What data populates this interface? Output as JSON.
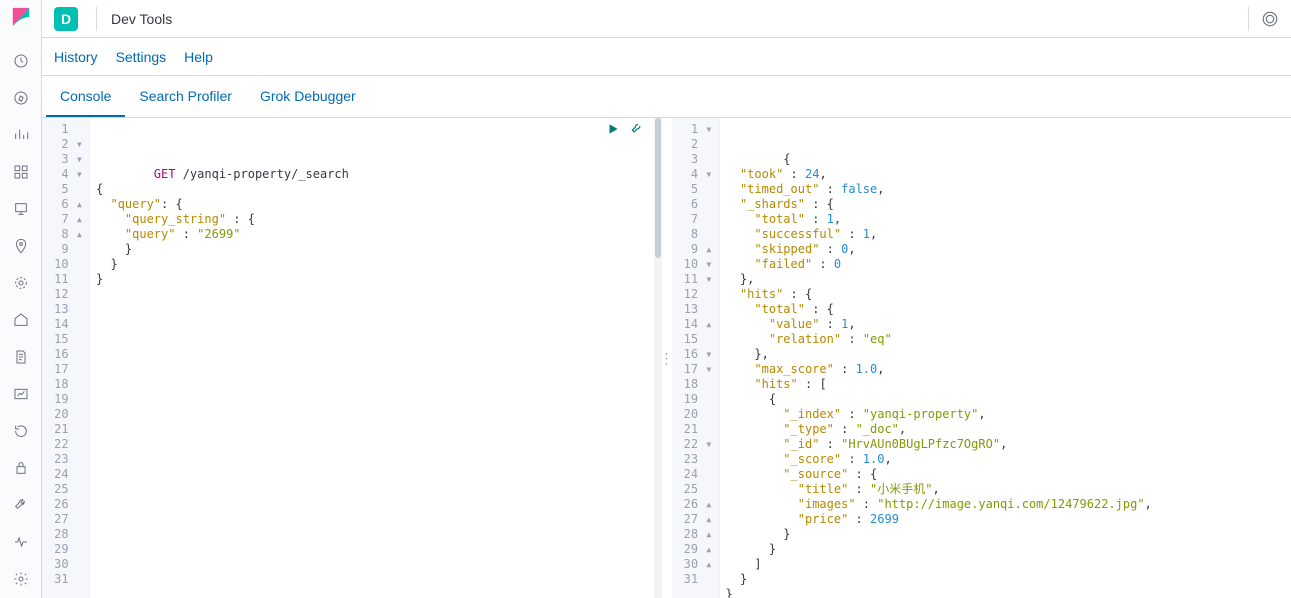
{
  "header": {
    "badge_letter": "D",
    "title": "Dev Tools"
  },
  "menubar": {
    "history": "History",
    "settings": "Settings",
    "help": "Help"
  },
  "tabs": {
    "console": "Console",
    "search_profiler": "Search Profiler",
    "grok_debugger": "Grok Debugger",
    "active": "console"
  },
  "request_editor": {
    "total_lines": 31,
    "gutter_markers": {
      "2": "▾",
      "3": "▾",
      "4": "▾",
      "6": "▴",
      "7": "▴",
      "8": "▴"
    },
    "code": {
      "method": "GET",
      "path": "/yanqi-property/_search",
      "lines": [
        {
          "n": 1,
          "type": "req"
        },
        {
          "n": 2,
          "raw": "{"
        },
        {
          "n": 3,
          "key": "query",
          "after": ": {"
        },
        {
          "n": 4,
          "key": "query_string",
          "after": " : {",
          "indent": "    "
        },
        {
          "n": 5,
          "key": "query",
          "after": " : ",
          "str": "2699",
          "indent": "    "
        },
        {
          "n": 6,
          "raw": "    }"
        },
        {
          "n": 7,
          "raw": "  }"
        },
        {
          "n": 8,
          "raw": "}"
        }
      ]
    }
  },
  "response_editor": {
    "total_lines": 31,
    "gutter_markers": {
      "1": "▾",
      "4": "▾",
      "9": "▴",
      "10": "▾",
      "11": "▾",
      "14": "▴",
      "16": "▾",
      "17": "▾",
      "22": "▾",
      "26": "▴",
      "27": "▴",
      "28": "▴",
      "29": "▴",
      "30": "▴"
    },
    "json": {
      "took": 24,
      "timed_out": false,
      "_shards": {
        "total": 1,
        "successful": 1,
        "skipped": 0,
        "failed": 0
      },
      "hits": {
        "total": {
          "value": 1,
          "relation": "eq"
        },
        "max_score": 1.0,
        "hits": [
          {
            "_index": "yanqi-property",
            "_type": "_doc",
            "_id": "HrvAUn0BUgLPfzc7OgRO",
            "_score": 1.0,
            "_source": {
              "title": "小米手机",
              "images": "http://image.yanqi.com/12479622.jpg",
              "price": 2699
            }
          }
        ]
      }
    }
  }
}
